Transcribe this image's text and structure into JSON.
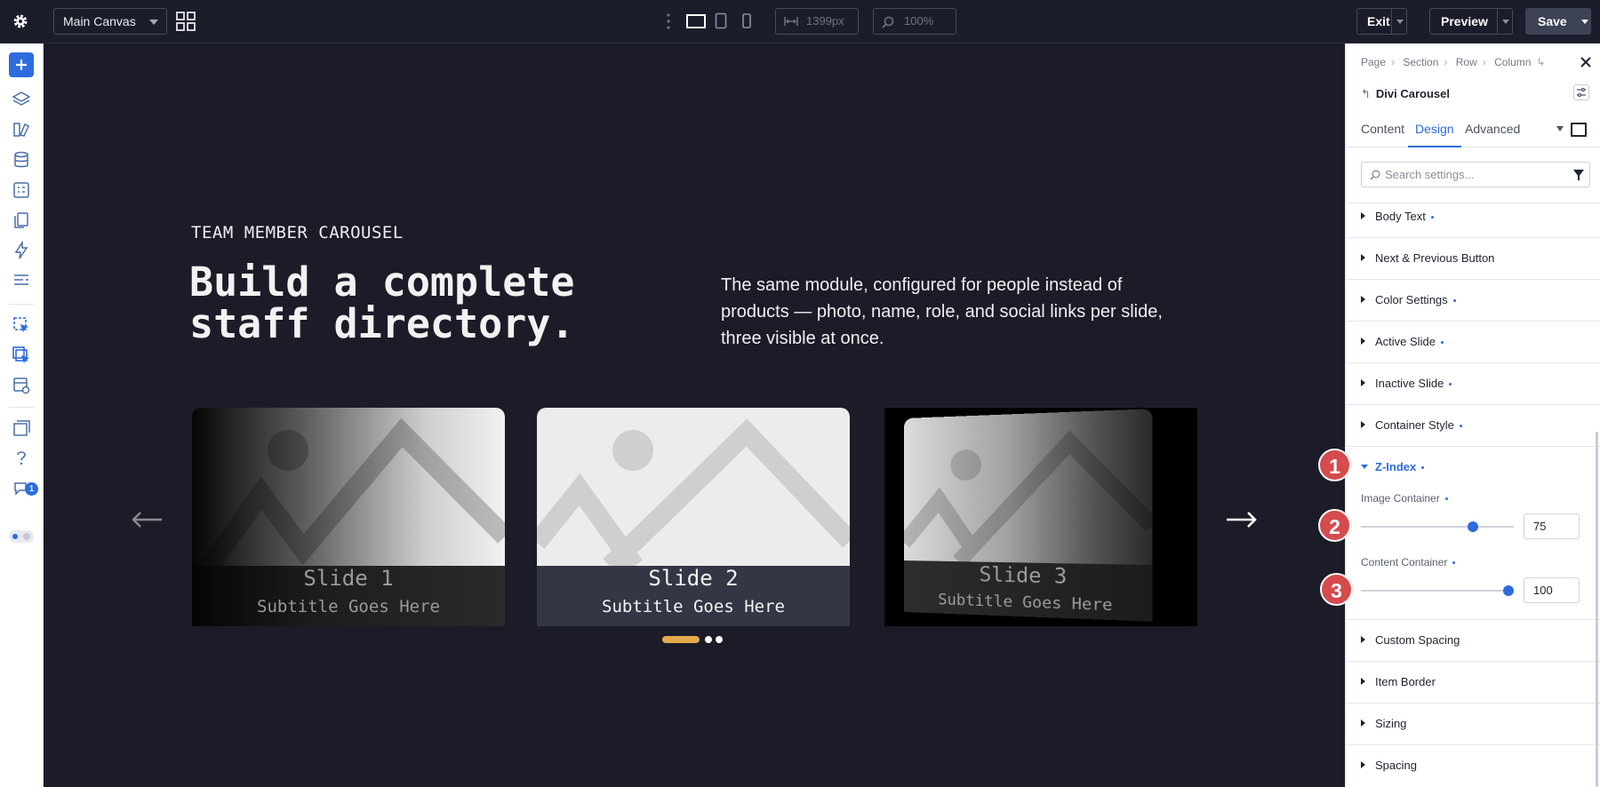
{
  "topbar": {
    "canvas_select": "Main Canvas",
    "width_value": "1399px",
    "zoom_value": "100%",
    "exit_label": "Exit",
    "preview_label": "Preview",
    "save_label": "Save"
  },
  "sidebar": {
    "notification_count": "1"
  },
  "canvas": {
    "eyebrow": "TEAM MEMBER CAROUSEL",
    "headline": "Build a complete staff directory.",
    "intro": "The same module, configured for people instead of products — photo, name, role, and social links per slide, three visible at once.",
    "slides": [
      {
        "title": "Slide 1",
        "subtitle": "Subtitle Goes Here"
      },
      {
        "title": "Slide 2",
        "subtitle": "Subtitle Goes Here"
      },
      {
        "title": "Slide 3",
        "subtitle": "Subtitle Goes Here"
      }
    ],
    "pager_active_color": "#e3a94c"
  },
  "panel": {
    "breadcrumb": [
      "Page",
      "Section",
      "Row",
      "Column"
    ],
    "module_title": "Divi Carousel",
    "tabs": [
      "Content",
      "Design",
      "Advanced"
    ],
    "active_tab": "Design",
    "search_placeholder": "Search settings...",
    "groups": [
      {
        "label": "Body Text",
        "modified": true
      },
      {
        "label": "Next & Previous Button",
        "modified": false
      },
      {
        "label": "Color Settings",
        "modified": true
      },
      {
        "label": "Active Slide",
        "modified": true
      },
      {
        "label": "Inactive Slide",
        "modified": true
      },
      {
        "label": "Container Style",
        "modified": true
      },
      {
        "label": "Z-Index",
        "modified": true,
        "open": true
      },
      {
        "label": "Custom Spacing",
        "modified": false
      },
      {
        "label": "Item Border",
        "modified": false
      },
      {
        "label": "Sizing",
        "modified": false
      },
      {
        "label": "Spacing",
        "modified": false
      }
    ],
    "zindex": {
      "image_label": "Image Container",
      "image_value": "75",
      "content_label": "Content Container",
      "content_value": "100"
    },
    "accent_color": "#2d6cdf"
  },
  "markers": [
    "1",
    "2",
    "3"
  ]
}
